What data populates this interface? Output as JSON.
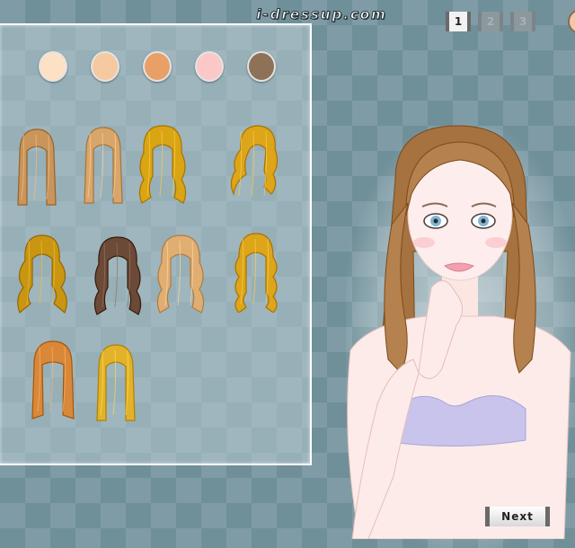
{
  "header": {
    "site_logo": "i-dressup.com"
  },
  "pager": {
    "pages": [
      {
        "label": "1",
        "state": "active"
      },
      {
        "label": "2",
        "state": "inactive"
      },
      {
        "label": "3",
        "state": "inactive"
      }
    ]
  },
  "skin_tones": [
    {
      "name": "skin-tone-1",
      "color": "#fde1c4"
    },
    {
      "name": "skin-tone-2",
      "color": "#f6c9a0"
    },
    {
      "name": "skin-tone-3",
      "color": "#e8a067"
    },
    {
      "name": "skin-tone-4",
      "color": "#fbc8c8"
    },
    {
      "name": "skin-tone-5",
      "color": "#8e7258"
    }
  ],
  "hairstyles": [
    {
      "style": "straight-long",
      "color": "#c9955a"
    },
    {
      "style": "straight-long",
      "color": "#d8a66a"
    },
    {
      "style": "wavy-long",
      "color": "#d9a514"
    },
    {
      "style": "curly-side",
      "color": "#dca51a"
    },
    {
      "style": "messy-wavy",
      "color": "#c99612"
    },
    {
      "style": "wavy-long",
      "color": "#6b4a38"
    },
    {
      "style": "wavy-long",
      "color": "#e0ae72"
    },
    {
      "style": "curly-long",
      "color": "#dca51a"
    },
    {
      "style": "straight-bangs",
      "color": "#d9883a"
    },
    {
      "style": "straight-long",
      "color": "#e2b32a"
    }
  ],
  "model": {
    "hair_color": "#b4814f",
    "bra_color": "#c8c4ec"
  },
  "controls": {
    "next_label": "Next"
  }
}
